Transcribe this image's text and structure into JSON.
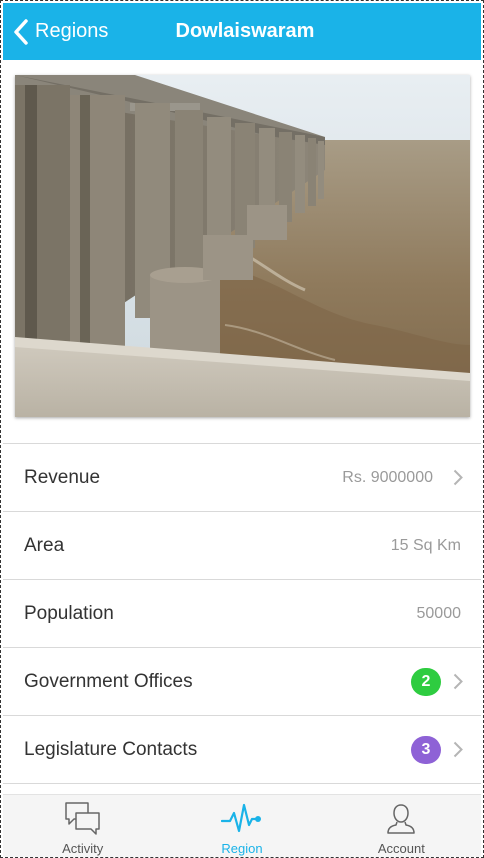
{
  "nav": {
    "back_label": "Regions",
    "title": "Dowlaiswaram"
  },
  "photo": {
    "icon": "photo-dam-barrage"
  },
  "details": [
    {
      "label": "Revenue",
      "value": "Rs. 9000000",
      "chevron": true
    },
    {
      "label": "Area",
      "value": "15 Sq Km",
      "chevron": false
    },
    {
      "label": "Population",
      "value": "50000",
      "chevron": false
    },
    {
      "label": "Government Offices",
      "badge": "2",
      "badge_color": "#2ecc40",
      "chevron": true
    },
    {
      "label": "Legislature Contacts",
      "badge": "3",
      "badge_color": "#8e62d6",
      "chevron": true
    }
  ],
  "tabs": [
    {
      "label": "Activity",
      "icon": "chat-bubbles-icon",
      "active": false
    },
    {
      "label": "Region",
      "icon": "pulse-icon",
      "active": true
    },
    {
      "label": "Account",
      "icon": "person-icon",
      "active": false
    }
  ],
  "colors": {
    "accent": "#1ab3e8",
    "badge_green": "#2ecc40",
    "badge_purple": "#8e62d6"
  }
}
